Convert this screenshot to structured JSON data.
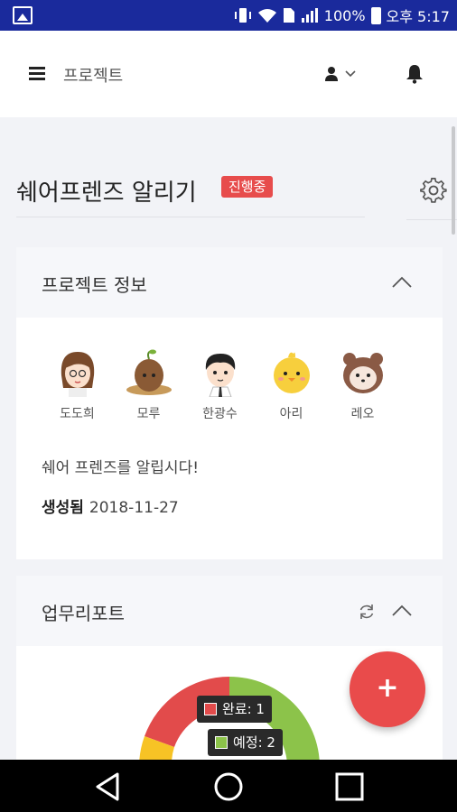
{
  "status_bar": {
    "battery": "100%",
    "time": "오후 5:17",
    "icons": [
      "image-icon",
      "vibrate-icon",
      "wifi-icon",
      "sim-icon",
      "signal-icon",
      "battery-icon"
    ]
  },
  "app_bar": {
    "title": "프로젝트",
    "icons": [
      "menu-icon",
      "user-icon",
      "chevron-down-icon",
      "bell-icon"
    ]
  },
  "project": {
    "title": "쉐어프렌즈 알리기",
    "status_badge": "진행중",
    "status_color": "#e74c4c"
  },
  "info_card": {
    "title": "프로젝트 정보",
    "members": [
      {
        "name": "도도희",
        "avatar": "girl-avatar"
      },
      {
        "name": "모루",
        "avatar": "potato-avatar"
      },
      {
        "name": "한광수",
        "avatar": "boy-avatar"
      },
      {
        "name": "아리",
        "avatar": "chick-avatar"
      },
      {
        "name": "레오",
        "avatar": "raccoon-avatar"
      }
    ],
    "description": "쉐어 프렌즈를 알립시다!",
    "created_label": "생성됨",
    "created_date": "2018-11-27"
  },
  "report_card": {
    "title": "업무리포트",
    "legend": [
      {
        "label": "완료: 1",
        "color": "#e24b4b"
      },
      {
        "label": "예정: 2",
        "color": "#8cc34a"
      }
    ],
    "chart_colors": {
      "done": "#e24b4b",
      "planned": "#8cc34a",
      "other": "#f7c325"
    }
  },
  "fab": {
    "label": "+"
  },
  "colors": {
    "accent": "#e94b4b",
    "status_bar": "#1a2a9c"
  }
}
